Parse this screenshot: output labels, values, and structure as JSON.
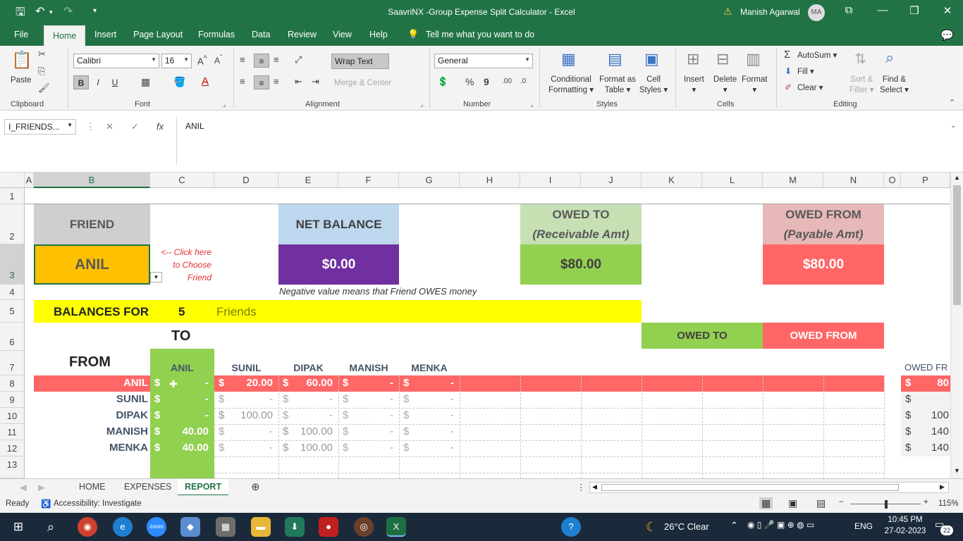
{
  "titlebar": {
    "title": "SaavriNX -Group Expense Split Calculator  -  Excel",
    "user": "Manish Agarwal",
    "avatar": "MA",
    "icons": [
      "save-icon",
      "undo-icon",
      "redo-icon",
      "customize-icon",
      "warning-icon",
      "ribbon-display-icon",
      "minimize-icon",
      "restore-icon",
      "close-icon"
    ]
  },
  "menu": {
    "tabs": [
      "File",
      "Home",
      "Insert",
      "Page Layout",
      "Formulas",
      "Data",
      "Review",
      "View",
      "Help"
    ],
    "active": "Home",
    "tell_me": "Tell me what you want to do"
  },
  "ribbon": {
    "clipboard": {
      "paste": "Paste",
      "label": "Clipboard"
    },
    "font": {
      "name": "Calibri",
      "size": "16",
      "bold": "B",
      "italic": "I",
      "underline": "U",
      "label": "Font"
    },
    "alignment": {
      "wrap": "Wrap Text",
      "merge": "Merge & Center",
      "label": "Alignment"
    },
    "number": {
      "format": "General",
      "label": "Number",
      "percent": "%",
      "comma": "9"
    },
    "styles": {
      "conditional": [
        "Conditional",
        "Formatting"
      ],
      "format_table": [
        "Format as",
        "Table"
      ],
      "cell_styles": [
        "Cell",
        "Styles"
      ],
      "label": "Styles"
    },
    "cells": {
      "insert": "Insert",
      "delete": "Delete",
      "format": "Format",
      "label": "Cells"
    },
    "editing": {
      "autosum": "AutoSum",
      "fill": "Fill",
      "clear": "Clear",
      "sort": [
        "Sort &",
        "Filter"
      ],
      "find": [
        "Find &",
        "Select"
      ],
      "label": "Editing"
    }
  },
  "formula_bar": {
    "name_box": "I_FRIENDS...",
    "value": "ANIL",
    "fx": "fx"
  },
  "columns": [
    "A",
    "B",
    "C",
    "D",
    "E",
    "F",
    "G",
    "H",
    "I",
    "J",
    "K",
    "L",
    "M",
    "N",
    "O",
    "P"
  ],
  "rows": [
    "1",
    "2",
    "3",
    "4",
    "5",
    "6",
    "7",
    "8",
    "9",
    "10",
    "11",
    "12",
    "13"
  ],
  "sheet": {
    "friend_label": "FRIEND",
    "friend_value": "ANIL",
    "click_note": [
      "<--  Click here",
      "to Choose",
      "Friend"
    ],
    "net_balance_label": "NET BALANCE",
    "net_balance_value": "$0.00",
    "owed_to_label": [
      "OWED TO",
      "(Receivable Amt)"
    ],
    "owed_to_value": "$80.00",
    "owed_from_label": [
      "OWED FROM",
      "(Payable Amt)"
    ],
    "owed_from_value": "$80.00",
    "negative_note": "Negative value means that Friend OWES money",
    "balances_for": "BALANCES FOR",
    "friend_count": "5",
    "friends_word": "Friends",
    "owed_to_small": "OWED TO",
    "owed_from_small": "OWED FROM",
    "to_label": "TO",
    "from_label": "FROM",
    "col_names": [
      "ANIL",
      "SUNIL",
      "DIPAK",
      "MANISH",
      "MENKA"
    ],
    "owed_fr_partial": "OWED FR",
    "matrix": [
      {
        "name": "ANIL",
        "cells": [
          "-",
          "20.00",
          "60.00",
          "-",
          "-"
        ],
        "p": "80"
      },
      {
        "name": "SUNIL",
        "cells": [
          "-",
          "-",
          "-",
          "-",
          "-"
        ],
        "p": ""
      },
      {
        "name": "DIPAK",
        "cells": [
          "-",
          "100.00",
          "-",
          "-",
          "-"
        ],
        "p": "100"
      },
      {
        "name": "MANISH",
        "cells": [
          "40.00",
          "-",
          "100.00",
          "-",
          "-"
        ],
        "p": "140"
      },
      {
        "name": "MENKA",
        "cells": [
          "40.00",
          "-",
          "100.00",
          "-",
          "-"
        ],
        "p": "140"
      }
    ],
    "currency": "$"
  },
  "sheet_tabs": [
    "HOME",
    "EXPENSES",
    "REPORT"
  ],
  "active_sheet": "REPORT",
  "status": {
    "ready": "Ready",
    "accessibility": "Accessibility: Investigate",
    "zoom": "115%"
  },
  "taskbar": {
    "weather": "26°C  Clear",
    "lang": "ENG",
    "time": "10:45 PM",
    "date": "27-02-2023",
    "notif": "22"
  },
  "colors": {
    "excel_green": "#217346",
    "friend_orange": "#ffc000",
    "net_purple": "#7030a0",
    "green": "#92d050",
    "red": "#ff6666",
    "yellow": "#ffff00",
    "grey": "#d0cece"
  }
}
